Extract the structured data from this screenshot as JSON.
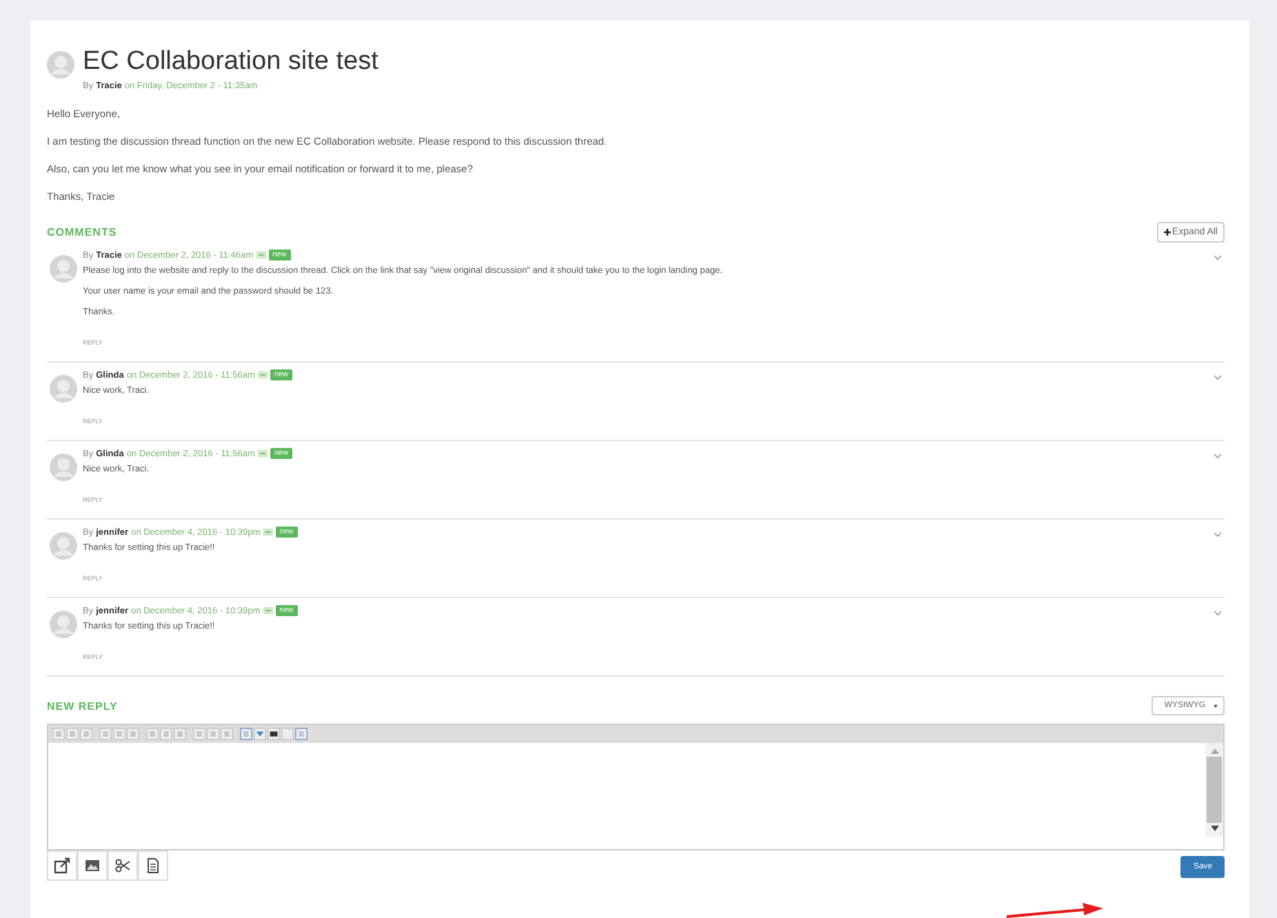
{
  "post": {
    "title": "EC Collaboration site test",
    "by": "By",
    "author": "Tracie",
    "on": "on",
    "date": "Friday, December 2 - 11:35am",
    "paragraphs": [
      "Hello Everyone,",
      "I am testing the discussion thread function on the new EC Collaboration website.  Please respond to this discussion thread.",
      "Also, can you let me know what you see in your email notification or forward it to me, please?",
      "Thanks,  Tracie"
    ]
  },
  "comments_heading": "COMMENTS",
  "expand_all": "Expand All",
  "comments": [
    {
      "by": "By",
      "author": "Tracie",
      "on": "on",
      "date": "December 2, 2016 - 11:46am",
      "badge": "new",
      "paragraphs": [
        "Please log into the website and reply to the discussion thread.  Click on the link that say \"view original discussion\" and it should take you to the login landing page.",
        "Your user name is your email and the password should be 123.",
        "Thanks."
      ],
      "reply": "REPLY"
    },
    {
      "by": "By",
      "author": "Glinda",
      "on": "on",
      "date": "December 2, 2016 - 11:56am",
      "badge": "new",
      "paragraphs": [
        "Nice work, Traci."
      ],
      "reply": "REPLY"
    },
    {
      "by": "By",
      "author": "Glinda",
      "on": "on",
      "date": "December 2, 2016 - 11:56am",
      "badge": "new",
      "paragraphs": [
        "Nice work, Traci."
      ],
      "reply": "REPLY"
    },
    {
      "by": "By",
      "author": "jennifer",
      "on": "on",
      "date": "December 4, 2016 - 10:39pm",
      "badge": "new",
      "paragraphs": [
        "Thanks for setting this up Tracie!!"
      ],
      "reply": "REPLY"
    },
    {
      "by": "By",
      "author": "jennifer",
      "on": "on",
      "date": "December 4, 2016 - 10:39pm",
      "badge": "new",
      "paragraphs": [
        "Thanks for setting this up Tracie!!"
      ],
      "reply": "REPLY"
    }
  ],
  "new_reply": {
    "heading": "NEW REPLY",
    "editor_mode": "WYSIWYG",
    "save": "Save"
  }
}
